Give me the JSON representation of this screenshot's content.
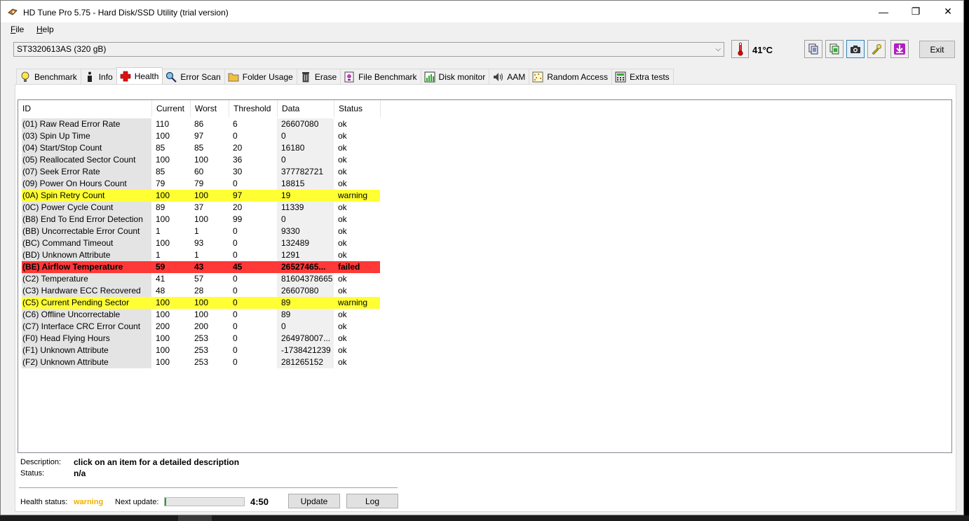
{
  "window": {
    "title": "HD Tune Pro 5.75 - Hard Disk/SSD Utility (trial version)",
    "minimize_glyph": "—",
    "maximize_glyph": "❐",
    "close_glyph": "✕"
  },
  "menu": {
    "file_u": "F",
    "file_rest": "ile",
    "help_u": "H",
    "help_rest": "elp"
  },
  "toolbar": {
    "drive": "ST3320613AS (320 gB)",
    "temperature": "41°C",
    "buttons": [
      "copy-text-icon",
      "copy-screen-icon",
      "screenshot-camera-icon",
      "options-wrench-icon",
      "save-download-icon"
    ],
    "exit_label": "Exit"
  },
  "tabs": [
    {
      "label": "Benchmark",
      "icon": "bulb-icon"
    },
    {
      "label": "Info",
      "icon": "info-icon"
    },
    {
      "label": "Health",
      "icon": "health-cross-icon",
      "active": true
    },
    {
      "label": "Error Scan",
      "icon": "magnifier-icon"
    },
    {
      "label": "Folder Usage",
      "icon": "folder-icon"
    },
    {
      "label": "Erase",
      "icon": "trash-icon"
    },
    {
      "label": "File Benchmark",
      "icon": "file-icon"
    },
    {
      "label": "Disk monitor",
      "icon": "chart-icon"
    },
    {
      "label": "AAM",
      "icon": "speaker-icon"
    },
    {
      "label": "Random Access",
      "icon": "grid-icon"
    },
    {
      "label": "Extra tests",
      "icon": "calculator-icon"
    }
  ],
  "health": {
    "columns": [
      "ID",
      "Current",
      "Worst",
      "Threshold",
      "Data",
      "Status"
    ],
    "rows": [
      {
        "id": "(01) Raw Read Error Rate",
        "current": "110",
        "worst": "86",
        "threshold": "6",
        "data": "26607080",
        "status": "ok",
        "level": "ok"
      },
      {
        "id": "(03) Spin Up Time",
        "current": "100",
        "worst": "97",
        "threshold": "0",
        "data": "0",
        "status": "ok",
        "level": "ok"
      },
      {
        "id": "(04) Start/Stop Count",
        "current": "85",
        "worst": "85",
        "threshold": "20",
        "data": "16180",
        "status": "ok",
        "level": "ok"
      },
      {
        "id": "(05) Reallocated Sector Count",
        "current": "100",
        "worst": "100",
        "threshold": "36",
        "data": "0",
        "status": "ok",
        "level": "ok"
      },
      {
        "id": "(07) Seek Error Rate",
        "current": "85",
        "worst": "60",
        "threshold": "30",
        "data": "377782721",
        "status": "ok",
        "level": "ok"
      },
      {
        "id": "(09) Power On Hours Count",
        "current": "79",
        "worst": "79",
        "threshold": "0",
        "data": "18815",
        "status": "ok",
        "level": "ok"
      },
      {
        "id": "(0A) Spin Retry Count",
        "current": "100",
        "worst": "100",
        "threshold": "97",
        "data": "19",
        "status": "warning",
        "level": "warn"
      },
      {
        "id": "(0C) Power Cycle Count",
        "current": "89",
        "worst": "37",
        "threshold": "20",
        "data": "11339",
        "status": "ok",
        "level": "ok"
      },
      {
        "id": "(B8) End To End Error Detection",
        "current": "100",
        "worst": "100",
        "threshold": "99",
        "data": "0",
        "status": "ok",
        "level": "ok"
      },
      {
        "id": "(BB) Uncorrectable Error Count",
        "current": "1",
        "worst": "1",
        "threshold": "0",
        "data": "9330",
        "status": "ok",
        "level": "ok"
      },
      {
        "id": "(BC) Command Timeout",
        "current": "100",
        "worst": "93",
        "threshold": "0",
        "data": "132489",
        "status": "ok",
        "level": "ok"
      },
      {
        "id": "(BD) Unknown Attribute",
        "current": "1",
        "worst": "1",
        "threshold": "0",
        "data": "1291",
        "status": "ok",
        "level": "ok"
      },
      {
        "id": "(BE) Airflow Temperature",
        "current": "59",
        "worst": "43",
        "threshold": "45",
        "data": "26527465...",
        "status": "failed",
        "level": "fail"
      },
      {
        "id": "(C2) Temperature",
        "current": "41",
        "worst": "57",
        "threshold": "0",
        "data": "81604378665",
        "status": "ok",
        "level": "ok"
      },
      {
        "id": "(C3) Hardware ECC Recovered",
        "current": "48",
        "worst": "28",
        "threshold": "0",
        "data": "26607080",
        "status": "ok",
        "level": "ok"
      },
      {
        "id": "(C5) Current Pending Sector",
        "current": "100",
        "worst": "100",
        "threshold": "0",
        "data": "89",
        "status": "warning",
        "level": "warn"
      },
      {
        "id": "(C6) Offline Uncorrectable",
        "current": "100",
        "worst": "100",
        "threshold": "0",
        "data": "89",
        "status": "ok",
        "level": "ok"
      },
      {
        "id": "(C7) Interface CRC Error Count",
        "current": "200",
        "worst": "200",
        "threshold": "0",
        "data": "0",
        "status": "ok",
        "level": "ok"
      },
      {
        "id": "(F0) Head Flying Hours",
        "current": "100",
        "worst": "253",
        "threshold": "0",
        "data": "264978007...",
        "status": "ok",
        "level": "ok"
      },
      {
        "id": "(F1) Unknown Attribute",
        "current": "100",
        "worst": "253",
        "threshold": "0",
        "data": "-1738421239",
        "status": "ok",
        "level": "ok"
      },
      {
        "id": "(F2) Unknown Attribute",
        "current": "100",
        "worst": "253",
        "threshold": "0",
        "data": "281265152",
        "status": "ok",
        "level": "ok"
      }
    ]
  },
  "description": {
    "label": "Description:",
    "value": "click on an item for a detailed description",
    "status_label": "Status:",
    "status_value": "n/a"
  },
  "footer": {
    "health_status_label": "Health status:",
    "health_status_value": "warning",
    "next_update_label": "Next update:",
    "progress_fraction": 0.02,
    "countdown": "4:50",
    "update_label": "Update",
    "log_label": "Log"
  },
  "colors": {
    "warning_row": "#ffff33",
    "failed_row": "#ff3838",
    "warning_text": "#f0b000",
    "progress_fill": "#06b025"
  }
}
